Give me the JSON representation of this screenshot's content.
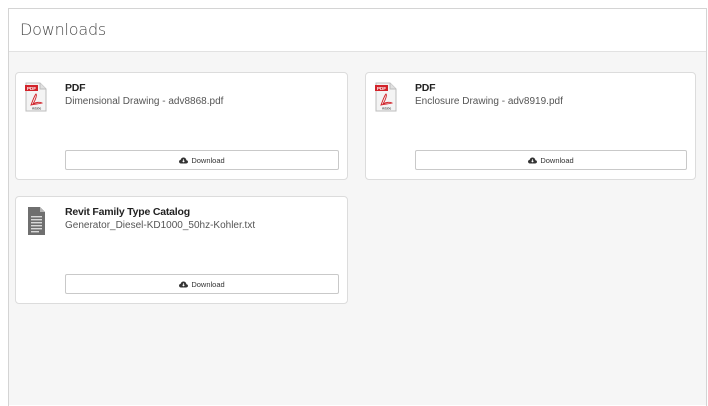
{
  "panel": {
    "title": "Downloads"
  },
  "downloads": [
    {
      "type": "PDF",
      "filename": "Dimensional Drawing - adv8868.pdf",
      "icon": "pdf-icon",
      "button_label": "Download"
    },
    {
      "type": "PDF",
      "filename": "Enclosure Drawing - adv8919.pdf",
      "icon": "pdf-icon",
      "button_label": "Download"
    },
    {
      "type": "Revit Family Type Catalog",
      "filename": "Generator_Diesel-KD1000_50hz-Kohler.txt",
      "icon": "text-file-icon",
      "button_label": "Download"
    }
  ],
  "colors": {
    "pdf_red": "#d2232a",
    "border": "#dcdcdc",
    "body_bg": "#f6f6f6"
  }
}
